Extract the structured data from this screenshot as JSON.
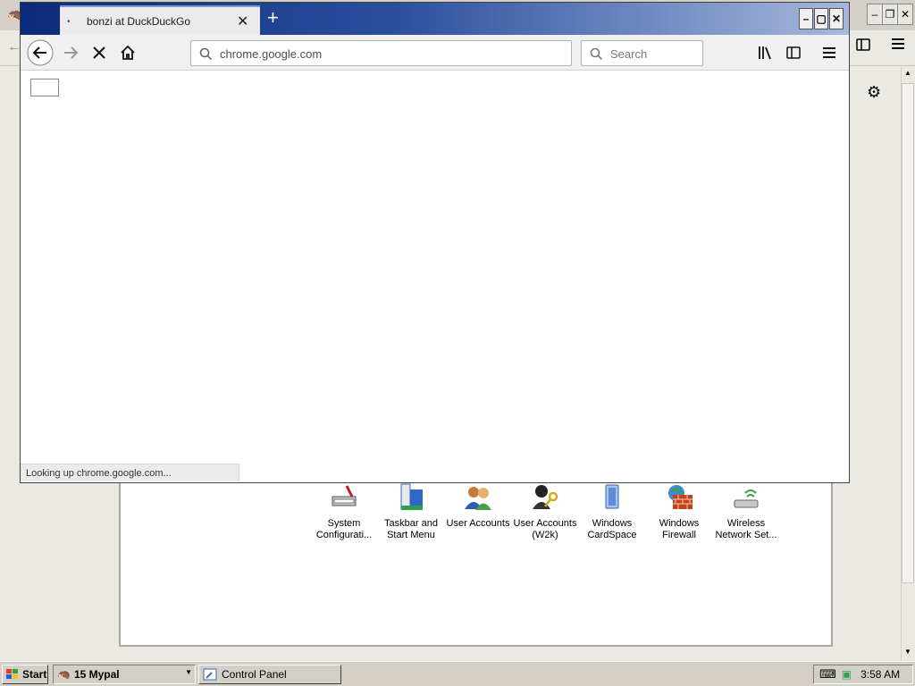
{
  "browser": {
    "tab_title": "bonzi at DuckDuckGo",
    "url": "chrome.google.com",
    "search_placeholder": "Search",
    "status": "Looking up chrome.google.com..."
  },
  "control_panel": {
    "items": [
      {
        "label": "System Configurati..."
      },
      {
        "label": "Taskbar and Start Menu"
      },
      {
        "label": "User Accounts"
      },
      {
        "label": "User Accounts (W2k)"
      },
      {
        "label": "Windows CardSpace"
      },
      {
        "label": "Windows Firewall"
      },
      {
        "label": "Wireless Network Set..."
      }
    ]
  },
  "taskbar": {
    "start_label": "Start",
    "quick_launch_label": "15 Mypal",
    "control_panel_task": "Control Panel",
    "clock": "3:58 AM"
  },
  "colors": {
    "title_gradient_start": "#0b2a7a",
    "title_gradient_end": "#a6b8dc",
    "taskbar": "#d4d0c8"
  }
}
